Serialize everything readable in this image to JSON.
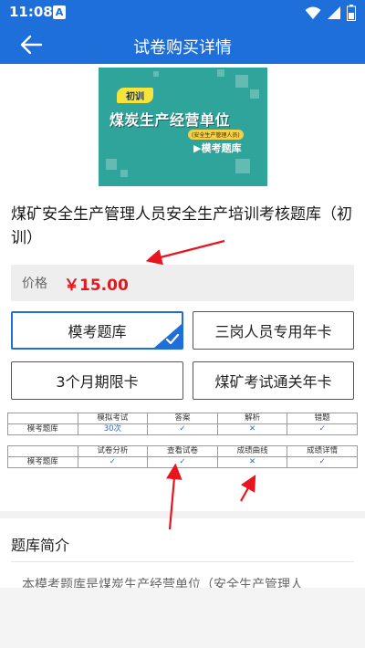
{
  "status_bar": {
    "time": "11:08",
    "notif_letter": "A"
  },
  "app_bar": {
    "title": "试卷购买详情"
  },
  "cover": {
    "tag": "初训",
    "title": "煤炭生产经营单位",
    "subtitle": "(安全生产管理人员)",
    "exam": "▶模考题库",
    "background_color": "#2fa49a"
  },
  "product": {
    "title": "煤矿安全生产管理人员安全生产培训考核题库（初训）",
    "price_label": "价格",
    "price_value": "￥15.00"
  },
  "options": [
    {
      "label": "模考题库",
      "selected": true
    },
    {
      "label": "三岗人员专用年卡",
      "selected": false
    },
    {
      "label": "3个月期限卡",
      "selected": false
    },
    {
      "label": "煤矿考试通关年卡",
      "selected": false
    }
  ],
  "feature_table_1": {
    "headers": [
      "",
      "模拟考试",
      "答案",
      "解析",
      "错题"
    ],
    "row": [
      "模考题库",
      "30次",
      "✓",
      "✕",
      "✓"
    ]
  },
  "feature_table_2": {
    "headers": [
      "",
      "试卷分析",
      "查看试卷",
      "成绩曲线",
      "成绩详情"
    ],
    "row": [
      "模考题库",
      "✓",
      "✓",
      "✕",
      "✓"
    ]
  },
  "intro": {
    "title": "题库简介",
    "text": "本模考题库是煤炭生产经营单位（安全生产管理人"
  },
  "colors": {
    "primary": "#1e6fd9",
    "price": "#e0191e",
    "annotation_arrow": "#e8141e"
  }
}
